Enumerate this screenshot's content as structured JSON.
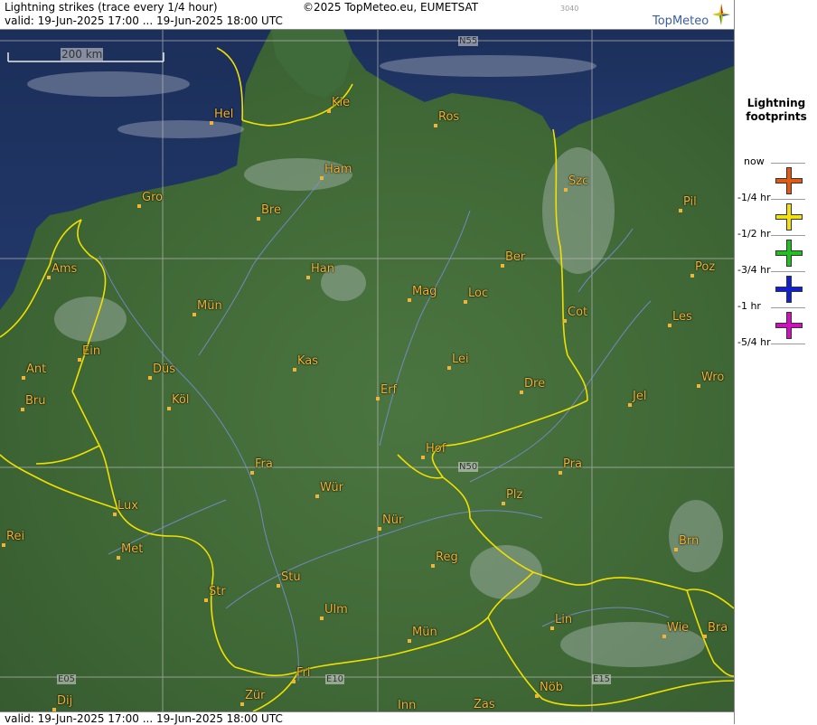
{
  "header": {
    "title": "Lightning strikes (trace every 1/4 hour)",
    "valid": "valid:  19-Jun-2025 17:00 ... 19-Jun-2025 18:00 UTC",
    "copyright": "©2025 TopMeteo.eu, EUMETSAT",
    "code": "3040",
    "logo": "TopMeteo"
  },
  "footer": {
    "valid": "valid:  19-Jun-2025 17:00 ... 19-Jun-2025 18:00 UTC"
  },
  "scale": {
    "label": "200 km"
  },
  "grid_labels": {
    "n55": "N55",
    "n50": "N50",
    "e05": "E05",
    "e10": "E10",
    "e15": "E15"
  },
  "legend": {
    "title_line1": "Lightning",
    "title_line2": "footprints",
    "items": [
      {
        "label": "now",
        "color": "#e05a10"
      },
      {
        "label": "-1/4 hr",
        "color": "#f0e010"
      },
      {
        "label": "-1/2 hr",
        "color": "#20c020"
      },
      {
        "label": "-3/4 hr",
        "color": "#1020d0"
      },
      {
        "label": "-1 hr",
        "color": "#d010c0"
      },
      {
        "label": "-5/4 hr",
        "color": ""
      }
    ]
  },
  "cities": [
    "Hel",
    "Kie",
    "Ros",
    "Ham",
    "Szc",
    "Gro",
    "Bre",
    "Pil",
    "Ber",
    "Ams",
    "Han",
    "Poz",
    "Mag",
    "Loc",
    "Mün",
    "Cot",
    "Les",
    "Ein",
    "Kas",
    "Lei",
    "Ant",
    "Düs",
    "Wro",
    "Dre",
    "Bru",
    "Köl",
    "Erf",
    "Jel",
    "Hof",
    "Fra",
    "Pra",
    "Wür",
    "Plz",
    "Lux",
    "Rei",
    "Nür",
    "Met",
    "Reg",
    "Brn",
    "Stu",
    "Str",
    "Ulm",
    "Lin",
    "Wie",
    "Bra",
    "Mün",
    "Fri",
    "Nöb",
    "Dij",
    "Zür",
    "Inn",
    "Zas"
  ]
}
